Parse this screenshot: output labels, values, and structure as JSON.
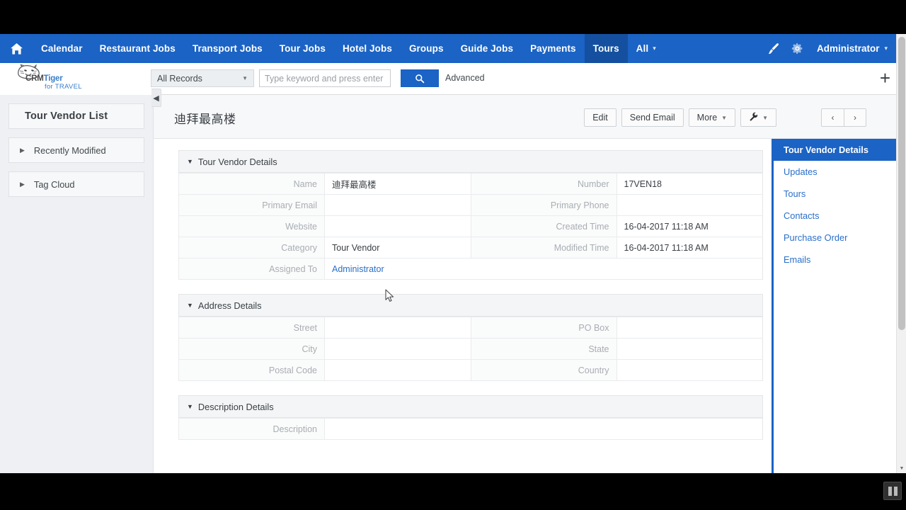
{
  "topnav": {
    "home_icon": "home-icon",
    "items": [
      {
        "label": "Calendar",
        "active": false
      },
      {
        "label": "Restaurant Jobs",
        "active": false
      },
      {
        "label": "Transport Jobs",
        "active": false
      },
      {
        "label": "Tour Jobs",
        "active": false
      },
      {
        "label": "Hotel Jobs",
        "active": false
      },
      {
        "label": "Groups",
        "active": false
      },
      {
        "label": "Guide Jobs",
        "active": false
      },
      {
        "label": "Payments",
        "active": false
      },
      {
        "label": "Tours",
        "active": true
      },
      {
        "label": "All",
        "active": false,
        "caret": true
      }
    ],
    "brush_icon": "paintbrush-icon",
    "gear_icon": "gear-icon",
    "user": "Administrator",
    "accent": "#1b63c4",
    "active_bg": "#14509f"
  },
  "logo": {
    "name_dark": "CRM",
    "name_light": "Tiger",
    "tagline": "for TRAVEL",
    "color": "#3a7dc8"
  },
  "search": {
    "scope": "All Records",
    "placeholder": "Type keyword and press enter",
    "value": "",
    "go_icon": "search-icon",
    "advanced": "Advanced",
    "add_icon": "plus-icon"
  },
  "sidebar": {
    "title": "Tour Vendor List",
    "items": [
      {
        "label": "Recently Modified"
      },
      {
        "label": "Tag Cloud"
      }
    ],
    "collapse_icon": "chevron-left-icon"
  },
  "record": {
    "title": "迪拜最高楼",
    "buttons": [
      {
        "label": "Edit",
        "caret": false,
        "icon": null
      },
      {
        "label": "Send Email",
        "caret": false,
        "icon": null
      },
      {
        "label": "More",
        "caret": true,
        "icon": null
      },
      {
        "label": "",
        "caret": true,
        "icon": "wrench-icon"
      }
    ],
    "pager": {
      "prev": "‹",
      "next": "›"
    }
  },
  "blocks": [
    {
      "title": "Tour Vendor Details",
      "rows": [
        [
          {
            "label": "Name",
            "value": "迪拜最高楼",
            "type": "text"
          },
          {
            "label": "Number",
            "value": "17VEN18",
            "type": "text"
          }
        ],
        [
          {
            "label": "Primary Email",
            "value": "",
            "type": "text"
          },
          {
            "label": "Primary Phone",
            "value": "",
            "type": "text"
          }
        ],
        [
          {
            "label": "Website",
            "value": "",
            "type": "text"
          },
          {
            "label": "Created Time",
            "value": "16-04-2017 11:18 AM",
            "type": "text"
          }
        ],
        [
          {
            "label": "Category",
            "value": "Tour Vendor",
            "type": "text"
          },
          {
            "label": "Modified Time",
            "value": "16-04-2017 11:18 AM",
            "type": "text"
          }
        ],
        [
          {
            "label": "Assigned To",
            "value": "Administrator",
            "type": "link",
            "span": true
          }
        ]
      ]
    },
    {
      "title": "Address Details",
      "rows": [
        [
          {
            "label": "Street",
            "value": "",
            "type": "text"
          },
          {
            "label": "PO Box",
            "value": "",
            "type": "text"
          }
        ],
        [
          {
            "label": "City",
            "value": "",
            "type": "text"
          },
          {
            "label": "State",
            "value": "",
            "type": "text"
          }
        ],
        [
          {
            "label": "Postal Code",
            "value": "",
            "type": "text"
          },
          {
            "label": "Country",
            "value": "",
            "type": "text"
          }
        ]
      ]
    },
    {
      "title": "Description Details",
      "rows": [
        [
          {
            "label": "Description",
            "value": "",
            "type": "text",
            "span": true
          }
        ]
      ]
    }
  ],
  "rightnav": {
    "items": [
      {
        "label": "Tour Vendor Details",
        "active": true
      },
      {
        "label": "Updates",
        "active": false
      },
      {
        "label": "Tours",
        "active": false
      },
      {
        "label": "Contacts",
        "active": false
      },
      {
        "label": "Purchase Order",
        "active": false
      },
      {
        "label": "Emails",
        "active": false
      }
    ]
  },
  "recorder": {
    "pause_icon": "pause-icon"
  }
}
